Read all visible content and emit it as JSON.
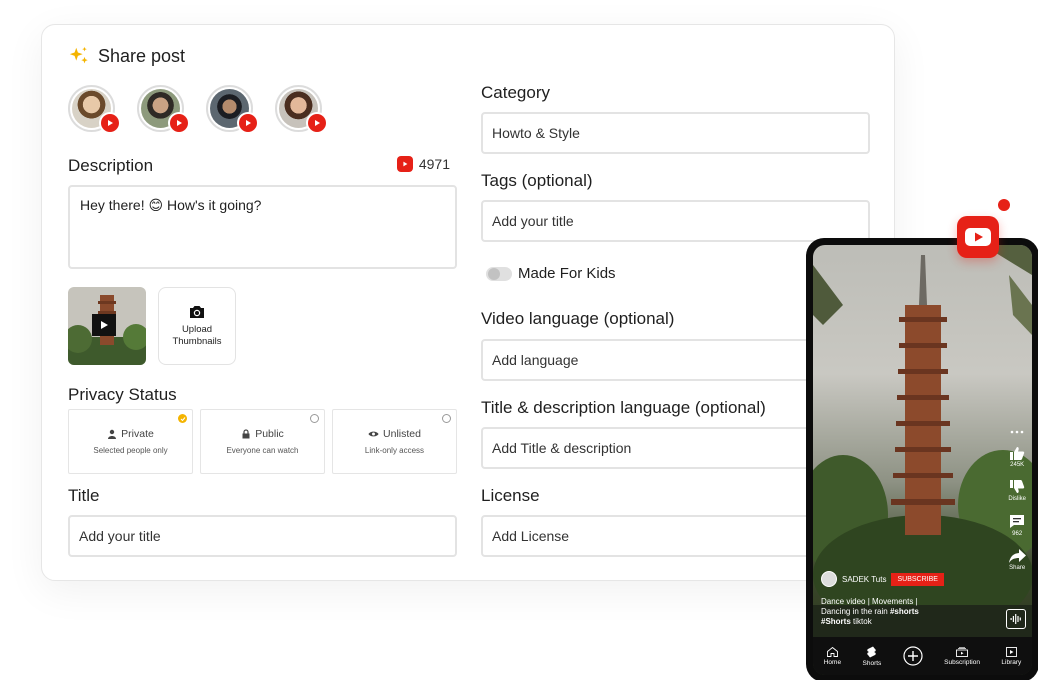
{
  "card": {
    "title": "Share post"
  },
  "accounts": [
    "youtube-channel-1",
    "youtube-channel-2",
    "youtube-channel-3",
    "youtube-channel-4"
  ],
  "description": {
    "label": "Description",
    "count": "4971",
    "value": "Hey there! 😊 How's it going?"
  },
  "media": {
    "upload_label_1": "Upload",
    "upload_label_2": "Thumbnails"
  },
  "privacy": {
    "label": "Privacy Status",
    "options": [
      {
        "title": "Private",
        "subtitle": "Selected people only",
        "selected": true
      },
      {
        "title": "Public",
        "subtitle": "Everyone can watch",
        "selected": false
      },
      {
        "title": "Unlisted",
        "subtitle": "Link-only access",
        "selected": false
      }
    ]
  },
  "title_field": {
    "label": "Title",
    "placeholder": "Add your title"
  },
  "category": {
    "label": "Category",
    "value": "Howto & Style"
  },
  "tags": {
    "label": "Tags (optional)",
    "placeholder": "Add your title"
  },
  "made_for_kids": {
    "label": "Made For Kids",
    "enabled": false
  },
  "video_language": {
    "label": "Video language (optional)",
    "placeholder": "Add language"
  },
  "title_desc_language": {
    "label": "Title & description language (optional)",
    "placeholder": "Add Title & description"
  },
  "license": {
    "label": "License",
    "placeholder": "Add License"
  },
  "phone": {
    "like_count": "245K",
    "dislike_label": "Dislike",
    "comment_count": "962",
    "share_label": "Share",
    "channel_name": "SADEK Tuts",
    "subscribe_label": "SUBSCRIBE",
    "caption_line_1": "Dance video | Movements |",
    "caption_line_2a": "Dancing in the rain ",
    "caption_tag_1": "#shorts",
    "caption_tag_2": "#Shorts",
    "caption_line_3b": " tiktok",
    "nav": [
      "Home",
      "Shorts",
      "",
      "Subscription",
      "Library"
    ]
  },
  "colors": {
    "youtube_red": "#e62117",
    "accent_yellow": "#f4b400"
  }
}
